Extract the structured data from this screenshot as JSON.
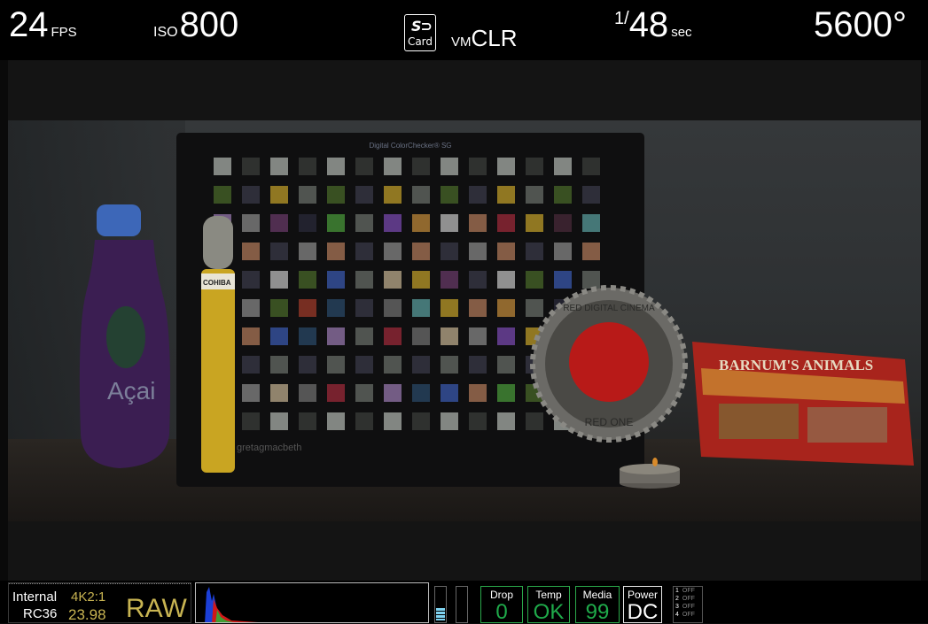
{
  "topbar": {
    "fps_value": "24",
    "fps_unit": "FPS",
    "iso_label": "ISO",
    "iso_value": "800",
    "card_brand": "SD",
    "card_label": "Card",
    "vm_label": "VM",
    "vm_value": "CLR",
    "shutter_num": "1/",
    "shutter_den": "48",
    "shutter_unit": "sec",
    "color_temp": "5600°"
  },
  "scene": {
    "checker_title": "Digital ColorChecker® SG",
    "checker_brand": "gretagmacbeth",
    "bottle_label": "Açai",
    "cigar_label": "COHIBA",
    "gear_text_top": "RED DIGITAL CINEMA",
    "gear_text_bottom": "RED ONE",
    "box_label": "BARNUM'S ANIMALS"
  },
  "status": {
    "source": "Internal",
    "resolution": "4K2:1",
    "codec": "RC36",
    "project_fps": "23.98",
    "format": "RAW",
    "audio_level": 0.3
  },
  "indicators": [
    {
      "label": "Drop",
      "value": "0"
    },
    {
      "label": "Temp",
      "value": "OK"
    },
    {
      "label": "Media",
      "value": "99"
    },
    {
      "label": "Power",
      "value": "DC"
    }
  ],
  "outputs": [
    {
      "num": "1",
      "state": "OFF"
    },
    {
      "num": "2",
      "state": "OFF"
    },
    {
      "num": "3",
      "state": "OFF"
    },
    {
      "num": "4",
      "state": "OFF"
    }
  ],
  "colors": {
    "accent_yellow": "#c8b452",
    "ok_green": "#1faa4a",
    "meter_blue": "#7fd3f0"
  }
}
